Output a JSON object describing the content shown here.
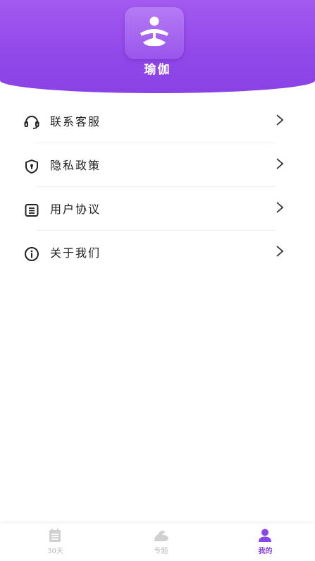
{
  "header": {
    "app_icon": "yoga-meditation-icon",
    "app_name": "瑜伽",
    "accent_color": "#9249ea"
  },
  "menu": {
    "items": [
      {
        "label": "联系客服",
        "icon": "headset-icon"
      },
      {
        "label": "隐私政策",
        "icon": "shield-lock-icon"
      },
      {
        "label": "用户协议",
        "icon": "document-list-icon"
      },
      {
        "label": "关于我们",
        "icon": "info-circle-icon"
      }
    ]
  },
  "tabbar": {
    "tabs": [
      {
        "label": "30天",
        "icon": "calendar-icon",
        "active": false
      },
      {
        "label": "专题",
        "icon": "flex-arm-icon",
        "active": false
      },
      {
        "label": "我的",
        "icon": "person-icon",
        "active": true
      }
    ],
    "active_color": "#8a45e6",
    "inactive_color": "#bbbbbb"
  }
}
